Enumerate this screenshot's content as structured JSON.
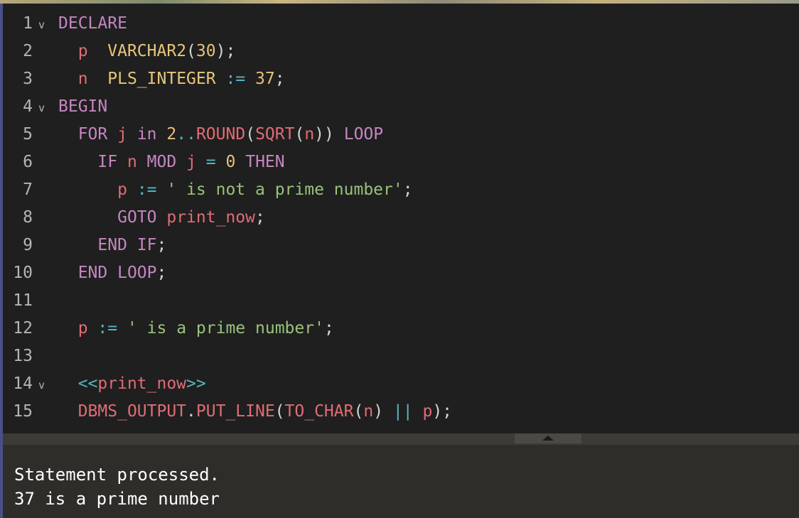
{
  "editor": {
    "lines": [
      {
        "num": "1",
        "fold": "v",
        "tokens": [
          [
            "DECLARE",
            "kw"
          ]
        ]
      },
      {
        "num": "2",
        "fold": "",
        "tokens": [
          [
            "  ",
            "pu"
          ],
          [
            "p",
            "vr"
          ],
          [
            "  ",
            "pu"
          ],
          [
            "VARCHAR2",
            "tp"
          ],
          [
            "(",
            "pu"
          ],
          [
            "30",
            "nm"
          ],
          [
            ");",
            "pu"
          ]
        ]
      },
      {
        "num": "3",
        "fold": "",
        "tokens": [
          [
            "  ",
            "pu"
          ],
          [
            "n",
            "vr"
          ],
          [
            "  ",
            "pu"
          ],
          [
            "PLS_INTEGER",
            "tp"
          ],
          [
            " ",
            "pu"
          ],
          [
            ":=",
            "op"
          ],
          [
            " ",
            "pu"
          ],
          [
            "37",
            "nm"
          ],
          [
            ";",
            "pu"
          ]
        ]
      },
      {
        "num": "4",
        "fold": "v",
        "tokens": [
          [
            "BEGIN",
            "kw"
          ]
        ]
      },
      {
        "num": "5",
        "fold": "",
        "tokens": [
          [
            "  ",
            "pu"
          ],
          [
            "FOR",
            "kw"
          ],
          [
            " ",
            "pu"
          ],
          [
            "j",
            "vr"
          ],
          [
            " ",
            "pu"
          ],
          [
            "in",
            "kw"
          ],
          [
            " ",
            "pu"
          ],
          [
            "2",
            "nm"
          ],
          [
            "..",
            "op"
          ],
          [
            "ROUND",
            "fn"
          ],
          [
            "(",
            "pu"
          ],
          [
            "SQRT",
            "fn"
          ],
          [
            "(",
            "pu"
          ],
          [
            "n",
            "vr"
          ],
          [
            "))",
            "pu"
          ],
          [
            " ",
            "pu"
          ],
          [
            "LOOP",
            "kw"
          ]
        ]
      },
      {
        "num": "6",
        "fold": "",
        "tokens": [
          [
            "    ",
            "pu"
          ],
          [
            "IF",
            "kw"
          ],
          [
            " ",
            "pu"
          ],
          [
            "n",
            "vr"
          ],
          [
            " ",
            "pu"
          ],
          [
            "MOD",
            "kw"
          ],
          [
            " ",
            "pu"
          ],
          [
            "j",
            "vr"
          ],
          [
            " ",
            "pu"
          ],
          [
            "=",
            "op"
          ],
          [
            " ",
            "pu"
          ],
          [
            "0",
            "nm"
          ],
          [
            " ",
            "pu"
          ],
          [
            "THEN",
            "kw"
          ]
        ]
      },
      {
        "num": "7",
        "fold": "",
        "tokens": [
          [
            "      ",
            "pu"
          ],
          [
            "p",
            "vr"
          ],
          [
            " ",
            "pu"
          ],
          [
            ":=",
            "op"
          ],
          [
            " ",
            "pu"
          ],
          [
            "' is not a prime number'",
            "st"
          ],
          [
            ";",
            "pu"
          ]
        ]
      },
      {
        "num": "8",
        "fold": "",
        "tokens": [
          [
            "      ",
            "pu"
          ],
          [
            "GOTO",
            "kw"
          ],
          [
            " ",
            "pu"
          ],
          [
            "print_now",
            "vr"
          ],
          [
            ";",
            "pu"
          ]
        ]
      },
      {
        "num": "9",
        "fold": "",
        "tokens": [
          [
            "    ",
            "pu"
          ],
          [
            "END IF",
            "kw"
          ],
          [
            ";",
            "pu"
          ]
        ]
      },
      {
        "num": "10",
        "fold": "",
        "tokens": [
          [
            "  ",
            "pu"
          ],
          [
            "END LOOP",
            "kw"
          ],
          [
            ";",
            "pu"
          ]
        ]
      },
      {
        "num": "11",
        "fold": "",
        "tokens": []
      },
      {
        "num": "12",
        "fold": "",
        "tokens": [
          [
            "  ",
            "pu"
          ],
          [
            "p",
            "vr"
          ],
          [
            " ",
            "pu"
          ],
          [
            ":=",
            "op"
          ],
          [
            " ",
            "pu"
          ],
          [
            "' is a prime number'",
            "st"
          ],
          [
            ";",
            "pu"
          ]
        ]
      },
      {
        "num": "13",
        "fold": "",
        "tokens": []
      },
      {
        "num": "14",
        "fold": "v",
        "tokens": [
          [
            "  ",
            "pu"
          ],
          [
            "<<",
            "op"
          ],
          [
            "print_now",
            "vr"
          ],
          [
            ">>",
            "op"
          ]
        ]
      },
      {
        "num": "15",
        "fold": "",
        "tokens": [
          [
            "  ",
            "pu"
          ],
          [
            "DBMS_OUTPUT",
            "fn"
          ],
          [
            ".",
            "pu"
          ],
          [
            "PUT_LINE",
            "fn"
          ],
          [
            "(",
            "pu"
          ],
          [
            "TO_CHAR",
            "fn"
          ],
          [
            "(",
            "pu"
          ],
          [
            "n",
            "vr"
          ],
          [
            ")",
            "pu"
          ],
          [
            " ",
            "pu"
          ],
          [
            "||",
            "op"
          ],
          [
            " ",
            "pu"
          ],
          [
            "p",
            "vr"
          ],
          [
            ");",
            "pu"
          ]
        ]
      }
    ]
  },
  "output": {
    "lines": [
      "Statement processed.",
      "37 is a prime number"
    ]
  },
  "colors": {
    "keyword": "#c586c0",
    "type": "#e8c67a",
    "identifier": "#e06c75",
    "number": "#e5c07b",
    "string": "#98c379",
    "operator": "#56b6c2"
  },
  "icons": {
    "fold": "chevron-down-icon",
    "splitter": "caret-up-icon"
  }
}
